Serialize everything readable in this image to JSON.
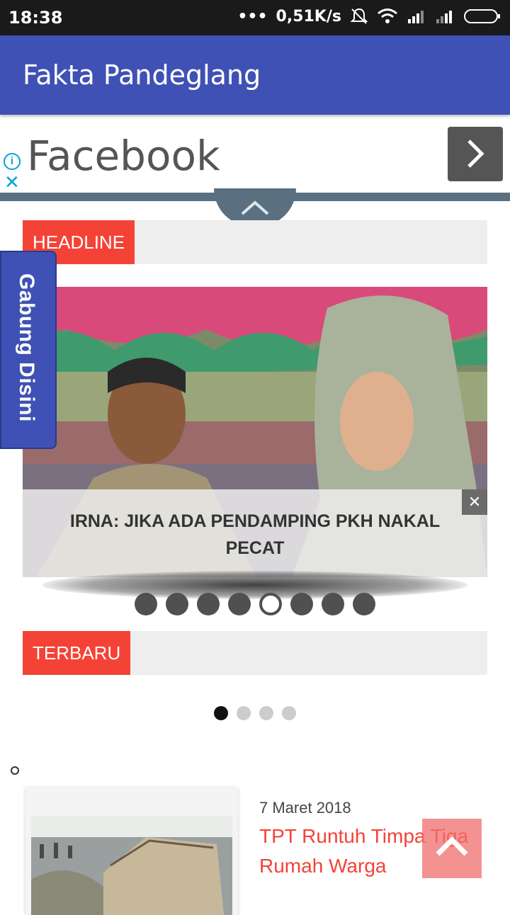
{
  "status_bar": {
    "time": "18:38",
    "network_speed": "0,51K/s",
    "icons": [
      "more-dots-icon",
      "bell-off-icon",
      "wifi-icon",
      "signal-icon",
      "signal-icon",
      "battery-icon"
    ]
  },
  "app_bar": {
    "title": "Fakta Pandeglang"
  },
  "ad": {
    "text": "Facebook",
    "icons": [
      "info-icon",
      "close-icon",
      "chevron-right-icon"
    ]
  },
  "headline_section": {
    "label": "HEADLINE"
  },
  "slider": {
    "caption": "IRNA: JIKA ADA PENDAMPING PKH NAKAL PECAT",
    "slide_count": 8,
    "active_index": 4
  },
  "side_tab": {
    "label": "Gabung Disini"
  },
  "latest_section": {
    "label": "TERBARU"
  },
  "pager": {
    "count": 4,
    "active_index": 0
  },
  "article": {
    "date": "7 Maret 2018",
    "title": "TPT Runtuh Timpa Tiga Rumah Warga"
  },
  "colors": {
    "primary": "#3f51b5",
    "accent": "#f44336",
    "ad_bar": "#5a7080"
  }
}
